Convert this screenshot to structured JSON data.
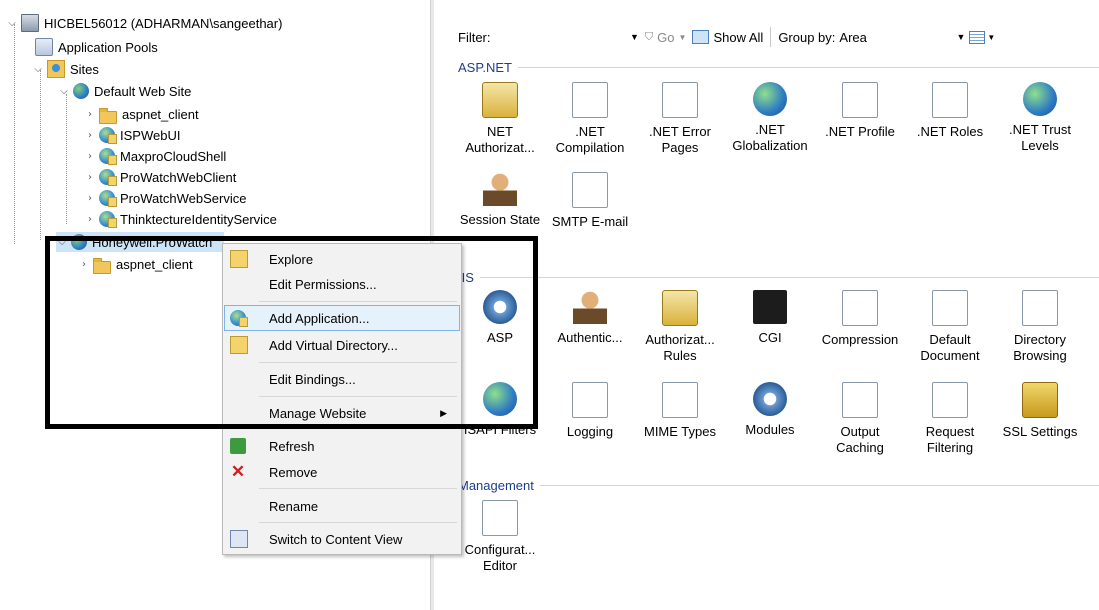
{
  "tree": {
    "server": "HICBEL56012 (ADHARMAN\\sangeethar)",
    "app_pools": "Application Pools",
    "sites": "Sites",
    "default_site": "Default Web Site",
    "default_children": [
      "aspnet_client",
      "ISPWebUI",
      "MaxproCloudShell",
      "ProWatchWebClient",
      "ProWatchWebService",
      "ThinktectureIdentityService"
    ],
    "honeywell_site": "Honeywell.ProWatch",
    "honeywell_children": [
      "aspnet_client"
    ]
  },
  "toolbar": {
    "filter_label": "Filter:",
    "go_label": "Go",
    "show_all_label": "Show All",
    "group_by_label": "Group by:",
    "group_by_value": "Area"
  },
  "groups": {
    "aspnet": "ASP.NET",
    "iis": "IIS",
    "management": "Management"
  },
  "features": {
    "aspnet": [
      [
        "NET",
        "Authorizat..."
      ],
      [
        ".NET",
        "Compilation"
      ],
      [
        ".NET Error",
        "Pages"
      ],
      [
        ".NET",
        "Globalization"
      ],
      [
        ".NET Profile",
        ""
      ],
      [
        ".NET Roles",
        ""
      ],
      [
        ".NET Trust",
        "Levels"
      ],
      [
        "Session State",
        ""
      ],
      [
        "SMTP E-mail",
        ""
      ]
    ],
    "iis": [
      [
        "ASP",
        ""
      ],
      [
        "Authentic...",
        ""
      ],
      [
        "Authorizat...",
        "Rules"
      ],
      [
        "CGI",
        ""
      ],
      [
        "Compression",
        ""
      ],
      [
        "Default",
        "Document"
      ],
      [
        "Directory",
        "Browsing"
      ],
      [
        "ISAPI Filters",
        ""
      ],
      [
        "Logging",
        ""
      ],
      [
        "MIME Types",
        ""
      ],
      [
        "Modules",
        ""
      ],
      [
        "Output",
        "Caching"
      ],
      [
        "Request",
        "Filtering"
      ],
      [
        "SSL Settings",
        ""
      ]
    ],
    "management": [
      [
        "Configurat...",
        "Editor"
      ]
    ]
  },
  "menu": {
    "explore": "Explore",
    "edit_permissions": "Edit Permissions...",
    "add_application": "Add Application...",
    "add_virtual_directory": "Add Virtual Directory...",
    "edit_bindings": "Edit Bindings...",
    "manage_website": "Manage Website",
    "refresh": "Refresh",
    "remove": "Remove",
    "rename": "Rename",
    "switch_content_view": "Switch to Content View"
  },
  "colors": {
    "group_header": "#1e3d8f",
    "selection": "#cce4f7",
    "menu_highlight": "#e5f1fb",
    "annotation_box": "#000000"
  }
}
